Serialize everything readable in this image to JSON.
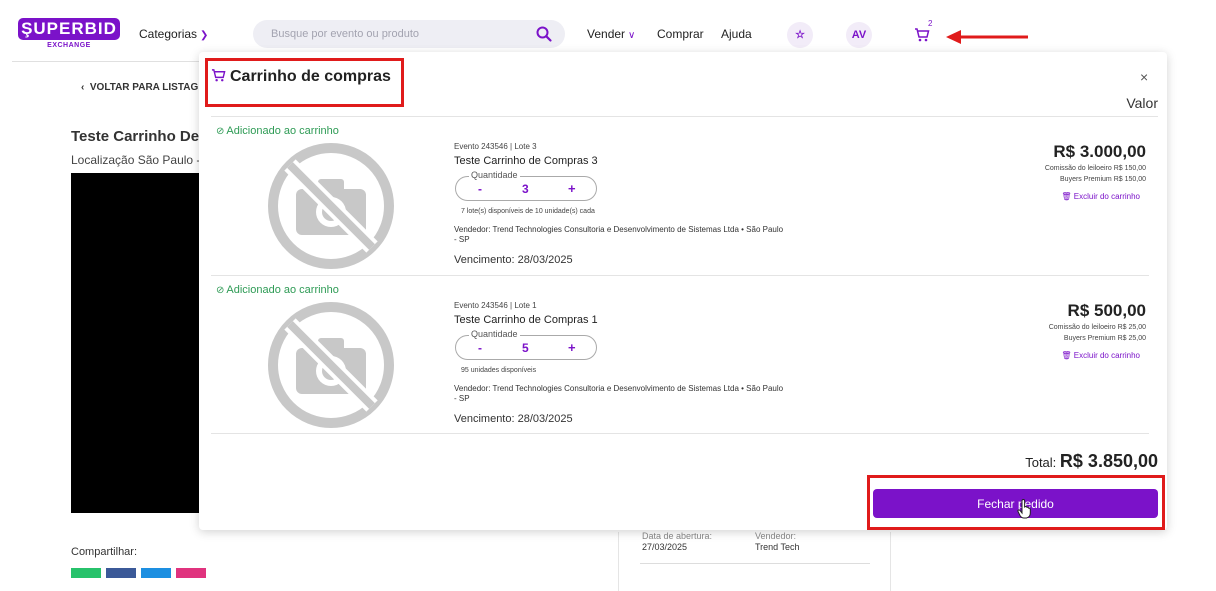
{
  "header": {
    "logo_main": "ŞUPERBID",
    "logo_sub": "EXCHANGE",
    "categories_label": "Categorias",
    "search_placeholder": "Busque por evento ou produto",
    "sell_label": "Vender",
    "buy_label": "Comprar",
    "help_label": "Ajuda",
    "avatar_initials": "AV",
    "cart_count": "2",
    "colors": {
      "brand": "#7b12c9",
      "annotation": "#e01b1b"
    }
  },
  "page": {
    "back_label": "VOLTAR PARA LISTAG",
    "title": "Teste Carrinho De",
    "location": "Localização São Paulo -",
    "share_label": "Compartilhar:",
    "opening_label": "Data de abertura:",
    "opening_value": "27/03/2025",
    "seller_label": "Vendedor:",
    "seller_value": "Trend Tech"
  },
  "cart": {
    "title": "Carrinho de compras",
    "close_label": "×",
    "value_header": "Valor",
    "items": [
      {
        "status": "Adicionado ao carrinho",
        "lot_info": "Evento 243546 | Lote 3",
        "name": "Teste Carrinho de Compras 3",
        "quantity_label": "Quantidade",
        "quantity": "3",
        "availability": "7 lote(s) disponíveis de 10 unidade(s) cada",
        "vendor": "Vendedor: Trend Technologies Consultoria e Desenvolvimento de Sistemas Ltda • São Paulo - SP",
        "due": "Vencimento: 28/03/2025",
        "price": "R$ 3.000,00",
        "auctioneer_fee": "Comissão do leiloeiro R$ 150,00",
        "buyers_premium": "Buyers Premium R$ 150,00",
        "remove_label": "Excluir do carrinho"
      },
      {
        "status": "Adicionado ao carrinho",
        "lot_info": "Evento 243546 | Lote 1",
        "name": "Teste Carrinho de Compras 1",
        "quantity_label": "Quantidade",
        "quantity": "5",
        "availability": "95 unidades disponíveis",
        "vendor": "Vendedor: Trend Technologies Consultoria e Desenvolvimento de Sistemas Ltda • São Paulo - SP",
        "due": "Vencimento: 28/03/2025",
        "price": "R$ 500,00",
        "auctioneer_fee": "Comissão do leiloeiro R$ 25,00",
        "buyers_premium": "Buyers Premium R$ 25,00",
        "remove_label": "Excluir do carrinho"
      }
    ],
    "total_label": "Total:",
    "total_value": "R$ 3.850,00",
    "close_order_label": "Fechar pedido"
  }
}
